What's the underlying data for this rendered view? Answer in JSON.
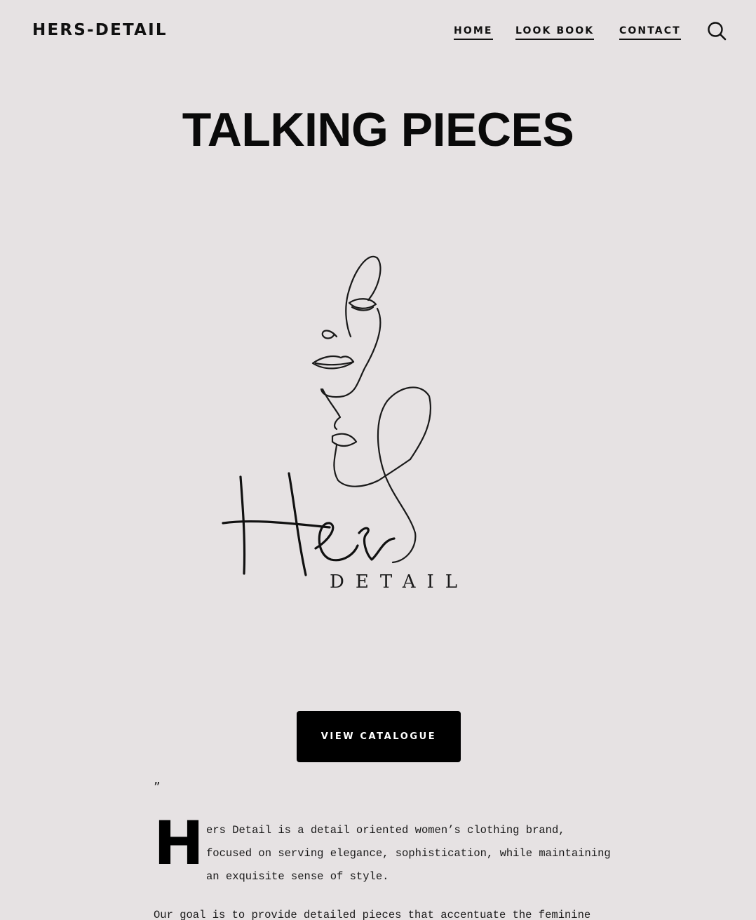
{
  "header": {
    "site_title": "HERS-DETAIL",
    "nav": [
      {
        "label": "HOME"
      },
      {
        "label": "LOOK BOOK"
      },
      {
        "label": "CONTACT"
      }
    ],
    "search_icon": "search-icon"
  },
  "main": {
    "title": "TALKING PIECES",
    "logo": {
      "script_text": "Her",
      "subtext": "DETAIL"
    },
    "cta_label": "VIEW CATALOGUE",
    "quote_mark": "”",
    "drop_cap": "H",
    "about_text": "ers Detail is a detail oriented women’s clothing brand, focused on serving elegance, sophistication, while maintaining an exquisite sense of style.",
    "goal_text": "Our goal is to provide detailed pieces that accentuate the feminine"
  },
  "colors": {
    "background": "#e6e2e3",
    "text": "#0f0f0f",
    "button_bg": "#000000",
    "button_text": "#ffffff"
  }
}
